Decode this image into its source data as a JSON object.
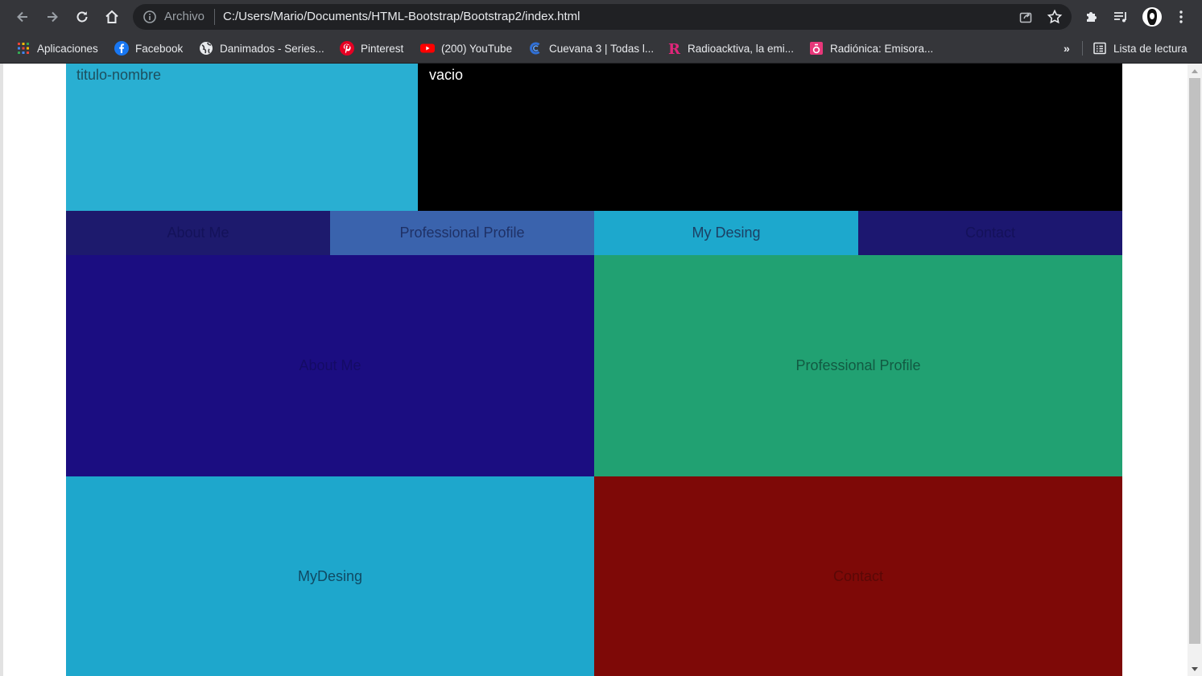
{
  "browser": {
    "omnibox": {
      "security_label": "Archivo",
      "url": "C:/Users/Mario/Documents/HTML-Bootstrap/Bootstrap2/index.html"
    },
    "bookmarks": [
      {
        "label": "Aplicaciones",
        "icon": "apps-grid-icon"
      },
      {
        "label": "Facebook",
        "icon": "facebook-icon"
      },
      {
        "label": "Danimados - Series...",
        "icon": "globe-icon"
      },
      {
        "label": "Pinterest",
        "icon": "pinterest-icon"
      },
      {
        "label": "(200) YouTube",
        "icon": "youtube-icon"
      },
      {
        "label": "Cuevana 3 | Todas l...",
        "icon": "cuevana-icon"
      },
      {
        "label": "Radioacktiva, la emi...",
        "icon": "radioacktiva-icon"
      },
      {
        "label": "Radiónica: Emisora...",
        "icon": "radionica-icon"
      }
    ],
    "more_bookmarks": "»",
    "reading_list": "Lista de lectura"
  },
  "page": {
    "header": {
      "title": "titulo-nombre",
      "right": "vacio"
    },
    "tabs": [
      {
        "label": "About Me",
        "color": "#1d1a6d"
      },
      {
        "label": "Professional Profile",
        "color": "#3a63ad"
      },
      {
        "label": "My Desing",
        "color": "#1da8cd"
      },
      {
        "label": "Contact",
        "color": "#1c1770"
      }
    ],
    "blocks": [
      {
        "label": "About Me",
        "color": "#1b0d81"
      },
      {
        "label": "Professional Profile",
        "color": "#21a172"
      },
      {
        "label": "MyDesing",
        "color": "#1ea7cc"
      },
      {
        "label": "Contact",
        "color": "#7e0907"
      }
    ]
  }
}
